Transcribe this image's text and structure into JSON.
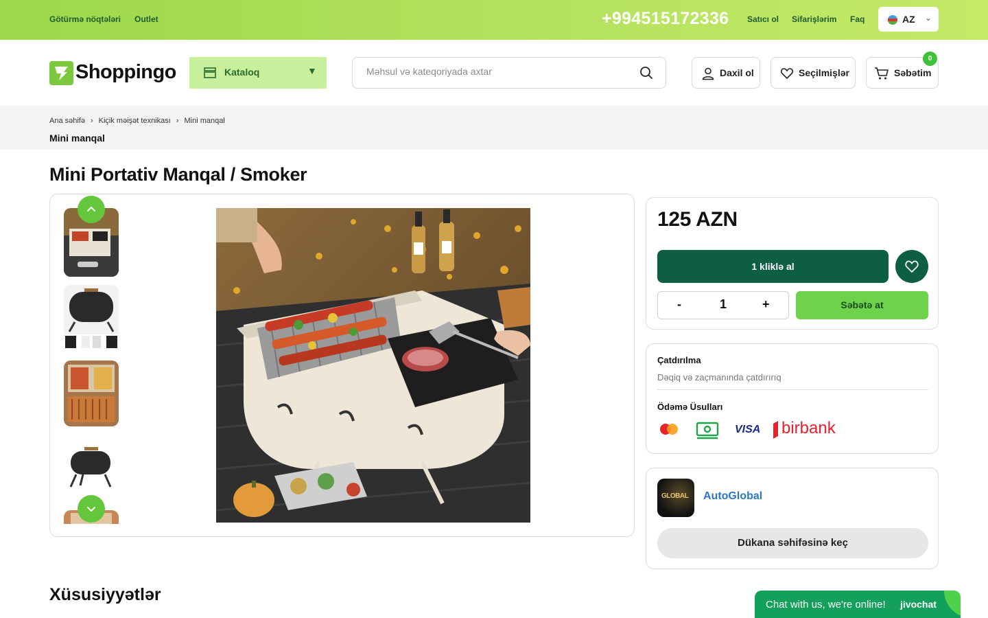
{
  "topbar": {
    "links": [
      "Götürmə nöqtələri",
      "Outlet"
    ],
    "phone": "+994515172336",
    "right_links": [
      "Satıcı ol",
      "Sifarişlərim",
      "Faq"
    ],
    "language": "AZ"
  },
  "header": {
    "logo_text": "Shoppingo",
    "catalog_label": "Kataloq",
    "search_placeholder": "Məhsul və kateqoriyada axtar",
    "login_label": "Daxil ol",
    "favorites_label": "Seçilmişlər",
    "cart_label": "Səbətim",
    "cart_count": "0"
  },
  "breadcrumb": {
    "items": [
      "Ana səhifə",
      "Kiçik məişət texnikası",
      "Mini manqal"
    ],
    "current": "Mini manqal"
  },
  "product": {
    "title": "Mini Portativ Manqal / Smoker",
    "price": "125 AZN",
    "buy_one_click": "1 kliklə al",
    "quantity": "1",
    "qty_minus": "-",
    "qty_plus": "+",
    "add_to_cart": "Səbətə at"
  },
  "delivery": {
    "title": "Çatdırılma",
    "text": "Dəqiq və zaçmanında çatdırırıq",
    "payment_title": "Ödəmə Üsulları",
    "payment_methods": [
      "mastercard-icon",
      "cash-icon",
      "VISA",
      "birbank"
    ]
  },
  "store": {
    "logo_text": "GLOBAL",
    "name": "AutoGlobal",
    "button": "Dükana səhifəsinə keç"
  },
  "sections": {
    "features_title": "Xüsusiyyətlər"
  },
  "chat": {
    "text": "Chat with us, we're online!",
    "brand": "jivochat"
  },
  "colors": {
    "topbar": "#9cd84a",
    "primary_dark": "#0e5e45",
    "accent_green": "#6fd24d",
    "store_link": "#2a77c9"
  }
}
